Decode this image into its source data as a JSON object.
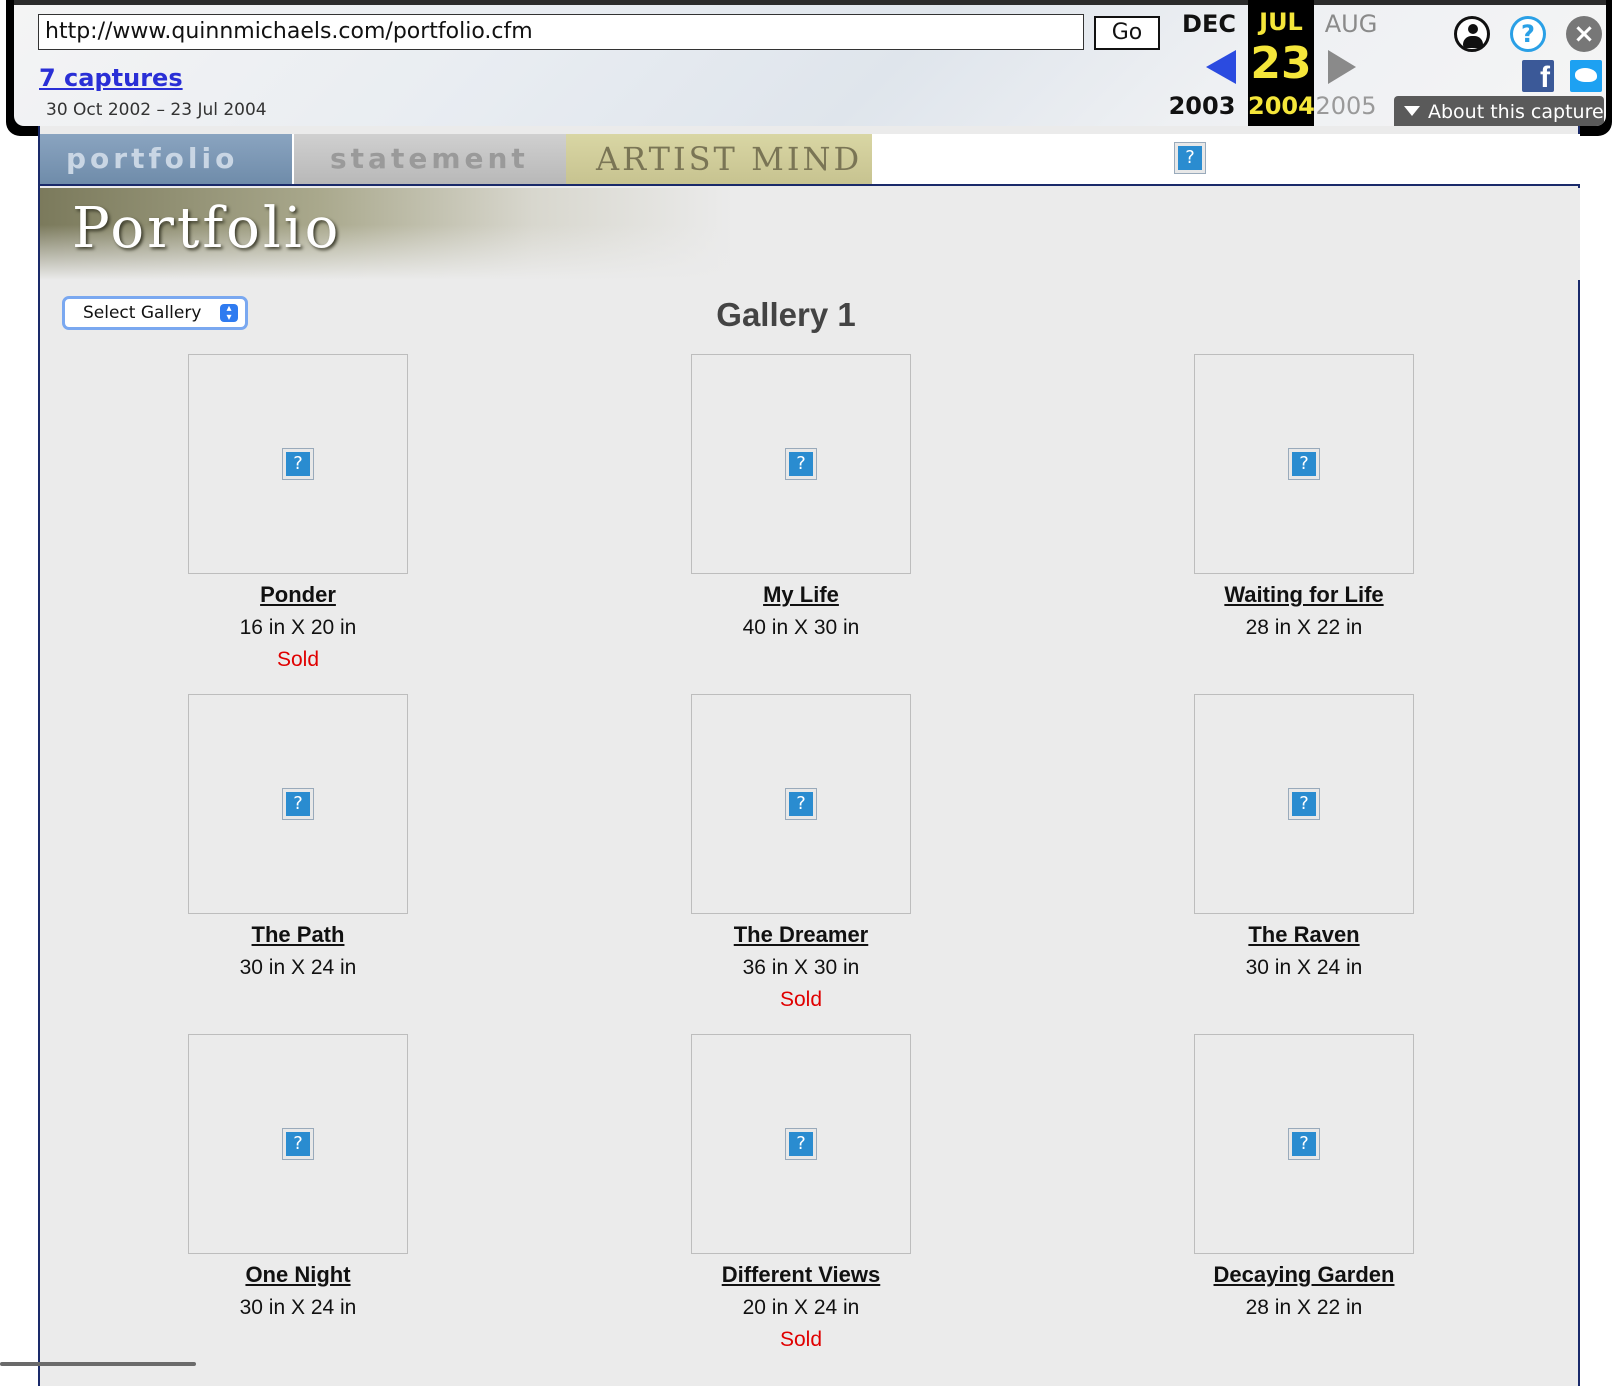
{
  "wayback": {
    "url": "http://www.quinnmichaels.com/portfolio.cfm",
    "go_label": "Go",
    "captures_label": "7 captures",
    "capture_range": "30 Oct 2002 – 23 Jul 2004",
    "prev_month": "DEC",
    "current_month": "JUL",
    "next_month": "AUG",
    "current_day": "23",
    "prev_year": "2003",
    "current_year": "2004",
    "next_year": "2005",
    "about_label": "About this capture",
    "icons": [
      "user-icon",
      "help-icon",
      "close-icon",
      "facebook-icon",
      "twitter-icon"
    ]
  },
  "nav": {
    "tabs": [
      {
        "label": "portfolio"
      },
      {
        "label": "statement"
      },
      {
        "label": "ARTIST MIND"
      }
    ]
  },
  "banner": {
    "title": "Portfolio"
  },
  "gallery": {
    "select_label": "Select Gallery",
    "title": "Gallery 1",
    "items": [
      {
        "title": "Ponder",
        "size": "16 in X 20 in",
        "status": "Sold"
      },
      {
        "title": "My Life",
        "size": "40 in X 30 in",
        "status": ""
      },
      {
        "title": "Waiting for Life",
        "size": "28 in X 22 in",
        "status": ""
      },
      {
        "title": "The Path",
        "size": "30 in X 24 in",
        "status": ""
      },
      {
        "title": "The Dreamer",
        "size": "36 in X 30 in",
        "status": "Sold"
      },
      {
        "title": "The Raven",
        "size": "30 in X 24 in",
        "status": ""
      },
      {
        "title": "One Night",
        "size": "30 in X 24 in",
        "status": ""
      },
      {
        "title": "Different Views",
        "size": "20 in X 24 in",
        "status": "Sold"
      },
      {
        "title": "Decaying Garden",
        "size": "28 in X 22 in",
        "status": ""
      }
    ]
  },
  "colors": {
    "sold": "#e00000",
    "link": "#2a2fd6",
    "current_date": "#f5e63a"
  }
}
